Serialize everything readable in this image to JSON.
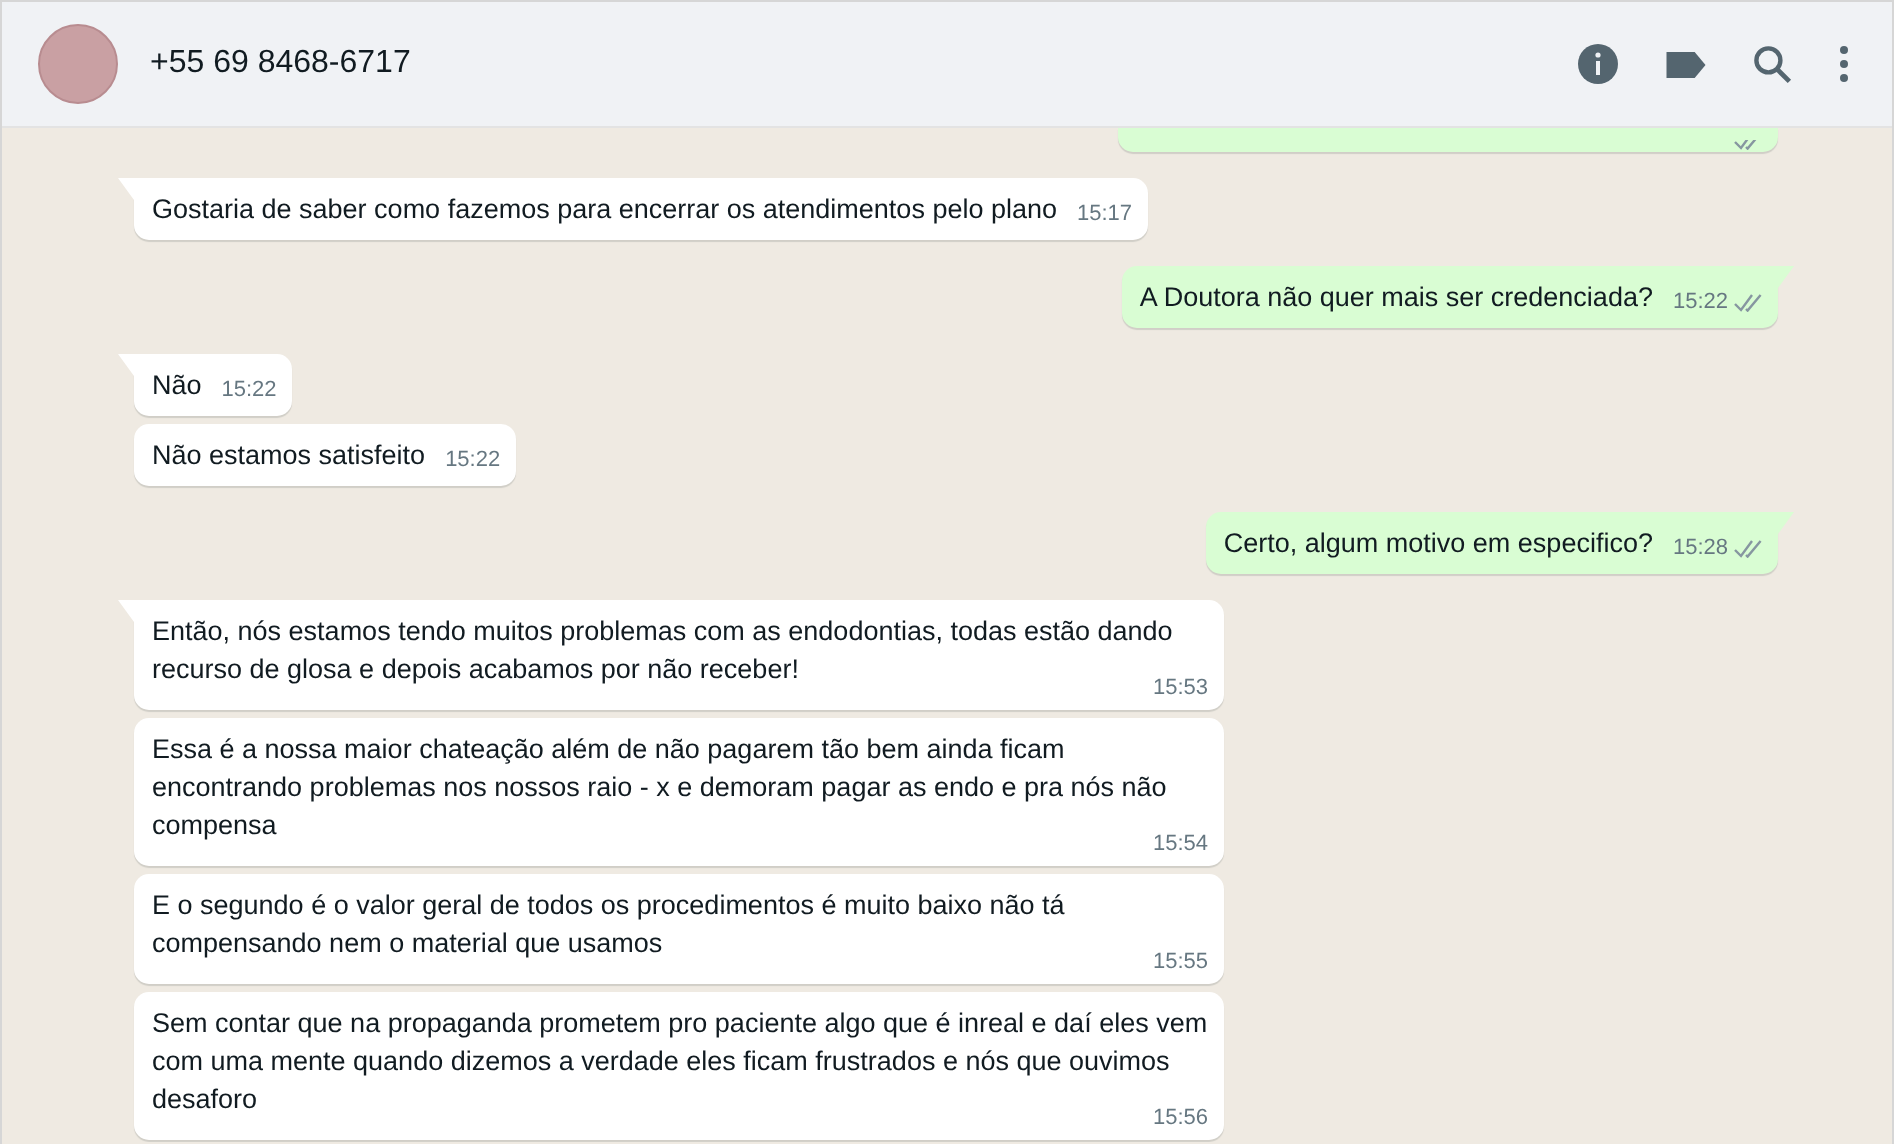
{
  "header": {
    "contact": "+55 69 8468-6717"
  },
  "messages": [
    {
      "kind": "clipped_outgoing",
      "read": false
    },
    {
      "kind": "incoming",
      "first": true,
      "text": "Gostaria de saber como fazemos para encerrar os atendimentos pelo plano",
      "time": "15:17"
    },
    {
      "kind": "outgoing",
      "first": true,
      "text": "A Doutora não quer mais ser credenciada?",
      "time": "15:22",
      "read": false
    },
    {
      "kind": "incoming",
      "first": true,
      "text": "Não",
      "time": "15:22"
    },
    {
      "kind": "incoming",
      "first": false,
      "text": "Não estamos satisfeito",
      "time": "15:22"
    },
    {
      "kind": "outgoing",
      "first": true,
      "text": "Certo, algum motivo em especifico?",
      "time": "15:28",
      "read": false
    },
    {
      "kind": "incoming",
      "first": true,
      "text": "Então, nós estamos tendo muitos problemas com as endodontias, todas estão dando recurso de glosa e depois acabamos por não receber!",
      "time": "15:53"
    },
    {
      "kind": "incoming",
      "first": false,
      "text": "Essa é a nossa maior chateação além de não pagarem tão bem ainda ficam encontrando problemas nos nossos raio - x e demoram pagar as endo e pra nós não compensa",
      "time": "15:54"
    },
    {
      "kind": "incoming",
      "first": false,
      "text": "E o segundo é o valor geral de todos os procedimentos é muito baixo não tá compensando nem o material que usamos",
      "time": "15:55"
    },
    {
      "kind": "incoming",
      "first": false,
      "text": "Sem contar que na propaganda prometem pro paciente algo que é inreal e daí eles vem com uma mente quando dizemos a verdade eles ficam frustrados e nós que ouvimos desaforo",
      "time": "15:56"
    }
  ]
}
